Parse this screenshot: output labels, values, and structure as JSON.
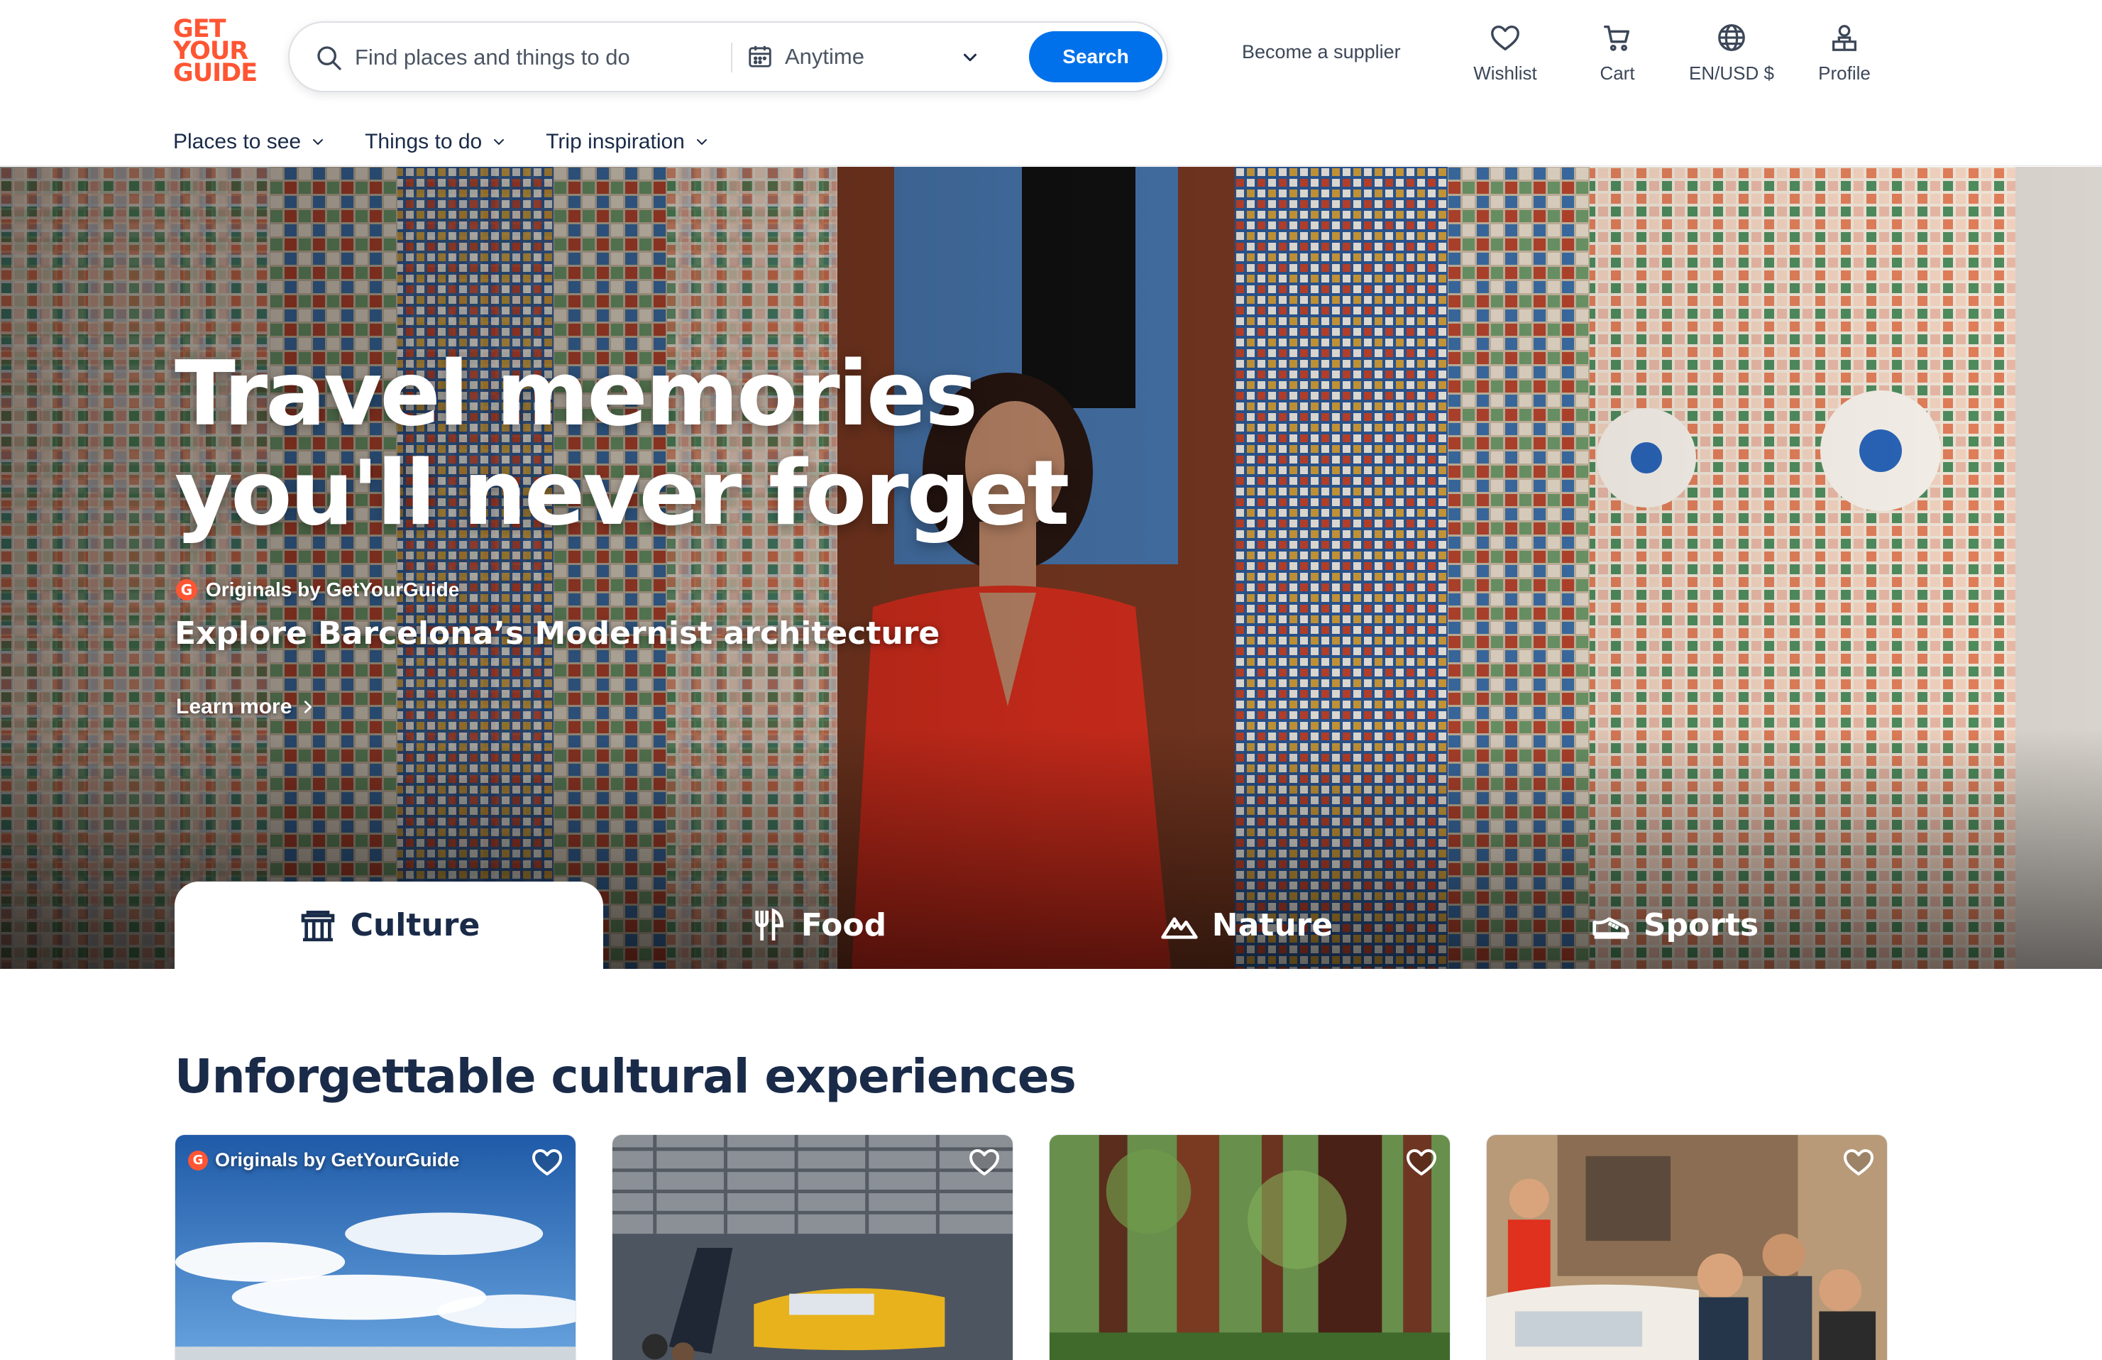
{
  "brand": {
    "logo_lines": [
      "GET",
      "YOUR",
      "GUIDE"
    ],
    "accent": "#ff5533",
    "primary_blue": "#0071eb",
    "navy": "#1a2b49"
  },
  "search": {
    "placeholder": "Find places and things to do",
    "date_label": "Anytime",
    "button_label": "Search"
  },
  "header": {
    "supplier_link": "Become a supplier",
    "actions": [
      {
        "label": "Wishlist",
        "icon": "heart-icon"
      },
      {
        "label": "Cart",
        "icon": "cart-icon"
      },
      {
        "label": "EN/USD $",
        "icon": "globe-icon"
      },
      {
        "label": "Profile",
        "icon": "profile-icon"
      }
    ]
  },
  "subnav": [
    {
      "label": "Places to see"
    },
    {
      "label": "Things to do"
    },
    {
      "label": "Trip inspiration"
    }
  ],
  "hero": {
    "title_line1": "Travel memories",
    "title_line2": "you'll never forget",
    "badge_letter": "G",
    "originals_label": "Originals by GetYourGuide",
    "subtitle": "Explore Barcelona’s Modernist architecture",
    "cta": "Learn more"
  },
  "tabs": [
    {
      "label": "Culture",
      "icon": "museum-icon",
      "active": true
    },
    {
      "label": "Food",
      "icon": "fork-knife-icon",
      "active": false
    },
    {
      "label": "Nature",
      "icon": "mountain-icon",
      "active": false
    },
    {
      "label": "Sports",
      "icon": "sneaker-icon",
      "active": false
    }
  ],
  "section": {
    "title": "Unforgettable cultural experiences",
    "cards": [
      {
        "image": "sky-clouds-photo",
        "originals_label": "Originals by GetYourGuide",
        "badge_letter": "G"
      },
      {
        "image": "aircraft-hangar-photo"
      },
      {
        "image": "redwood-forest-photo"
      },
      {
        "image": "vintage-car-tour-photo"
      }
    ]
  }
}
